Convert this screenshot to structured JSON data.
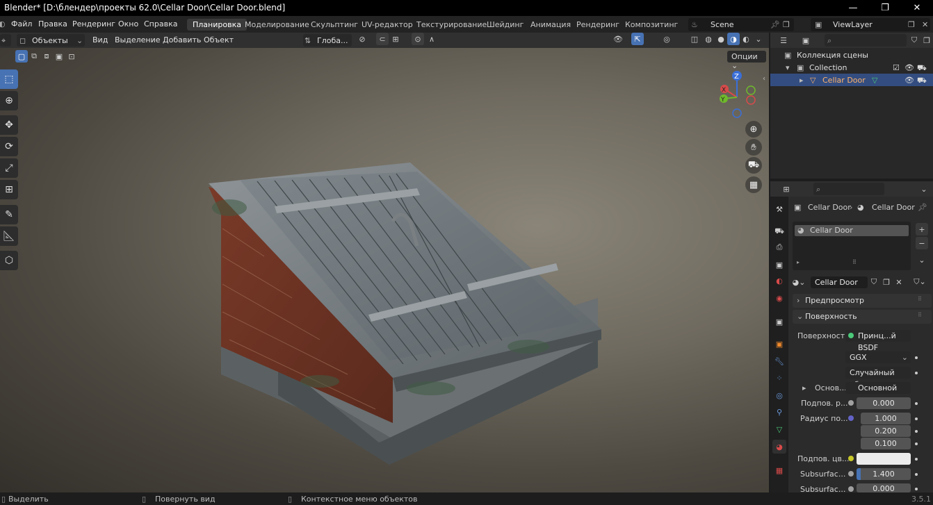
{
  "window": {
    "title": "Blender* [D:\\блендер\\проекты 62.0\\Cellar Door\\Cellar Door.blend]",
    "minimize": "—",
    "maximize": "❐",
    "close": "✕"
  },
  "menubar": {
    "items": [
      "Файл",
      "Правка",
      "Рендеринг",
      "Окно",
      "Справка"
    ],
    "workspaces": [
      "Планировка",
      "Моделирование",
      "Скульптинг",
      "UV-редактор",
      "Текстурирование",
      "Шейдинг",
      "Анимация",
      "Рендеринг",
      "Композитинг"
    ],
    "active_workspace": "Планировка",
    "scene": "Scene",
    "view_layer": "ViewLayer"
  },
  "viewport_header": {
    "mode": "Объекты",
    "menus": [
      "Вид",
      "Выделение",
      "Добавить",
      "Объект"
    ],
    "transform_orientation": "Глоба...",
    "options": "Опции"
  },
  "gizmo": {
    "z": "Z",
    "x": "X",
    "y": "Y"
  },
  "icons": {
    "select": "select-box-icon",
    "cursor": "cursor-icon",
    "move": "move-icon",
    "rotate": "rotate-icon",
    "scale": "scale-icon",
    "transform": "transform-icon",
    "annotate": "annotate-icon",
    "measure": "measure-icon",
    "add_cube": "add-cube-icon",
    "zoom": "zoom-icon",
    "hand": "hand-icon",
    "camera": "camera-icon",
    "grid": "grid-icon"
  },
  "outliner": {
    "scene_collection": "Коллекция сцены",
    "collection": "Collection",
    "object": "Cellar Door"
  },
  "properties": {
    "breadcrumb_object": "Cellar Door",
    "breadcrumb_material": "Cellar Door",
    "material_slot": "Cellar Door",
    "material_name": "Cellar Door",
    "preview_panel": "Предпросмотр",
    "surface_panel": "Поверхность",
    "surface_label": "Поверхность",
    "surface_value": "Принц...й BSDF",
    "distribution": "GGX",
    "subsurface_method": "Случайный об...",
    "base_color_label": "Основ...",
    "base_color_value": "Основной цвет",
    "subsurface_label": "Подпов. р...",
    "subsurface_value": "0.000",
    "radius_label": "Радиус по...",
    "radius_values": [
      "1.000",
      "0.200",
      "0.100"
    ],
    "subsurface_color_label": "Подпов. цв...",
    "subsurface_ior_label": "Subsurfac...",
    "subsurface_ior_value": "1.400",
    "subsurface_aniso_label": "Subsurfac...",
    "subsurface_aniso_value": "0.000"
  },
  "statusbar": {
    "select": "Выделить",
    "rotate": "Повернуть вид",
    "context": "Контекстное меню объектов",
    "version": "3.5.1"
  },
  "colors": {
    "accent": "#4772b3",
    "selected_object": "#ffb36b",
    "socket_yellow": "#c7c729",
    "socket_purple": "#6363c7",
    "socket_gray": "#a1a1a1",
    "socket_green": "#4bc97a"
  }
}
